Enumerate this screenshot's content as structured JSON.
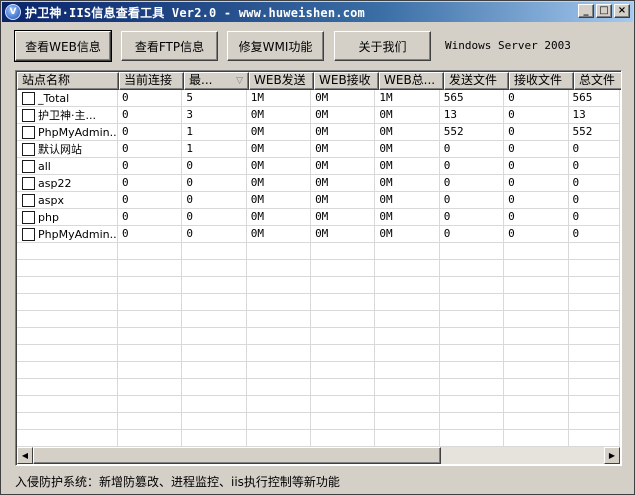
{
  "window": {
    "title": "护卫神·IIS信息查看工具 Ver2.0 - www.huweishen.com",
    "icon_glyph": "V",
    "minimize_glyph": "_",
    "maximize_glyph": "□",
    "close_glyph": "×"
  },
  "toolbar": {
    "web_info": "查看WEB信息",
    "ftp_info": "查看FTP信息",
    "fix_wmi": "修复WMI功能",
    "about": "关于我们",
    "os_label": "Windows Server 2003"
  },
  "table": {
    "columns": [
      "站点名称",
      "当前连接",
      "最...",
      "WEB发送",
      "WEB接收",
      "WEB总...",
      "发送文件",
      "接收文件",
      "总文件"
    ],
    "sort_indicator": "▽",
    "rows": [
      [
        "_Total",
        "0",
        "5",
        "1M",
        "0M",
        "1M",
        "565",
        "0",
        "565"
      ],
      [
        "护卫神·主...",
        "0",
        "3",
        "0M",
        "0M",
        "0M",
        "13",
        "0",
        "13"
      ],
      [
        "PhpMyAdmin...",
        "0",
        "1",
        "0M",
        "0M",
        "0M",
        "552",
        "0",
        "552"
      ],
      [
        "默认网站",
        "0",
        "1",
        "0M",
        "0M",
        "0M",
        "0",
        "0",
        "0"
      ],
      [
        "all",
        "0",
        "0",
        "0M",
        "0M",
        "0M",
        "0",
        "0",
        "0"
      ],
      [
        "asp22",
        "0",
        "0",
        "0M",
        "0M",
        "0M",
        "0",
        "0",
        "0"
      ],
      [
        "aspx",
        "0",
        "0",
        "0M",
        "0M",
        "0M",
        "0",
        "0",
        "0"
      ],
      [
        "php",
        "0",
        "0",
        "0M",
        "0M",
        "0M",
        "0",
        "0",
        "0"
      ],
      [
        "PhpMyAdmin...",
        "0",
        "0",
        "0M",
        "0M",
        "0M",
        "0",
        "0",
        "0"
      ]
    ]
  },
  "scroll": {
    "left_glyph": "◀",
    "right_glyph": "▶"
  },
  "status": {
    "text": "入侵防护系统：新增防篡改、进程监控、iis执行控制等新功能"
  }
}
